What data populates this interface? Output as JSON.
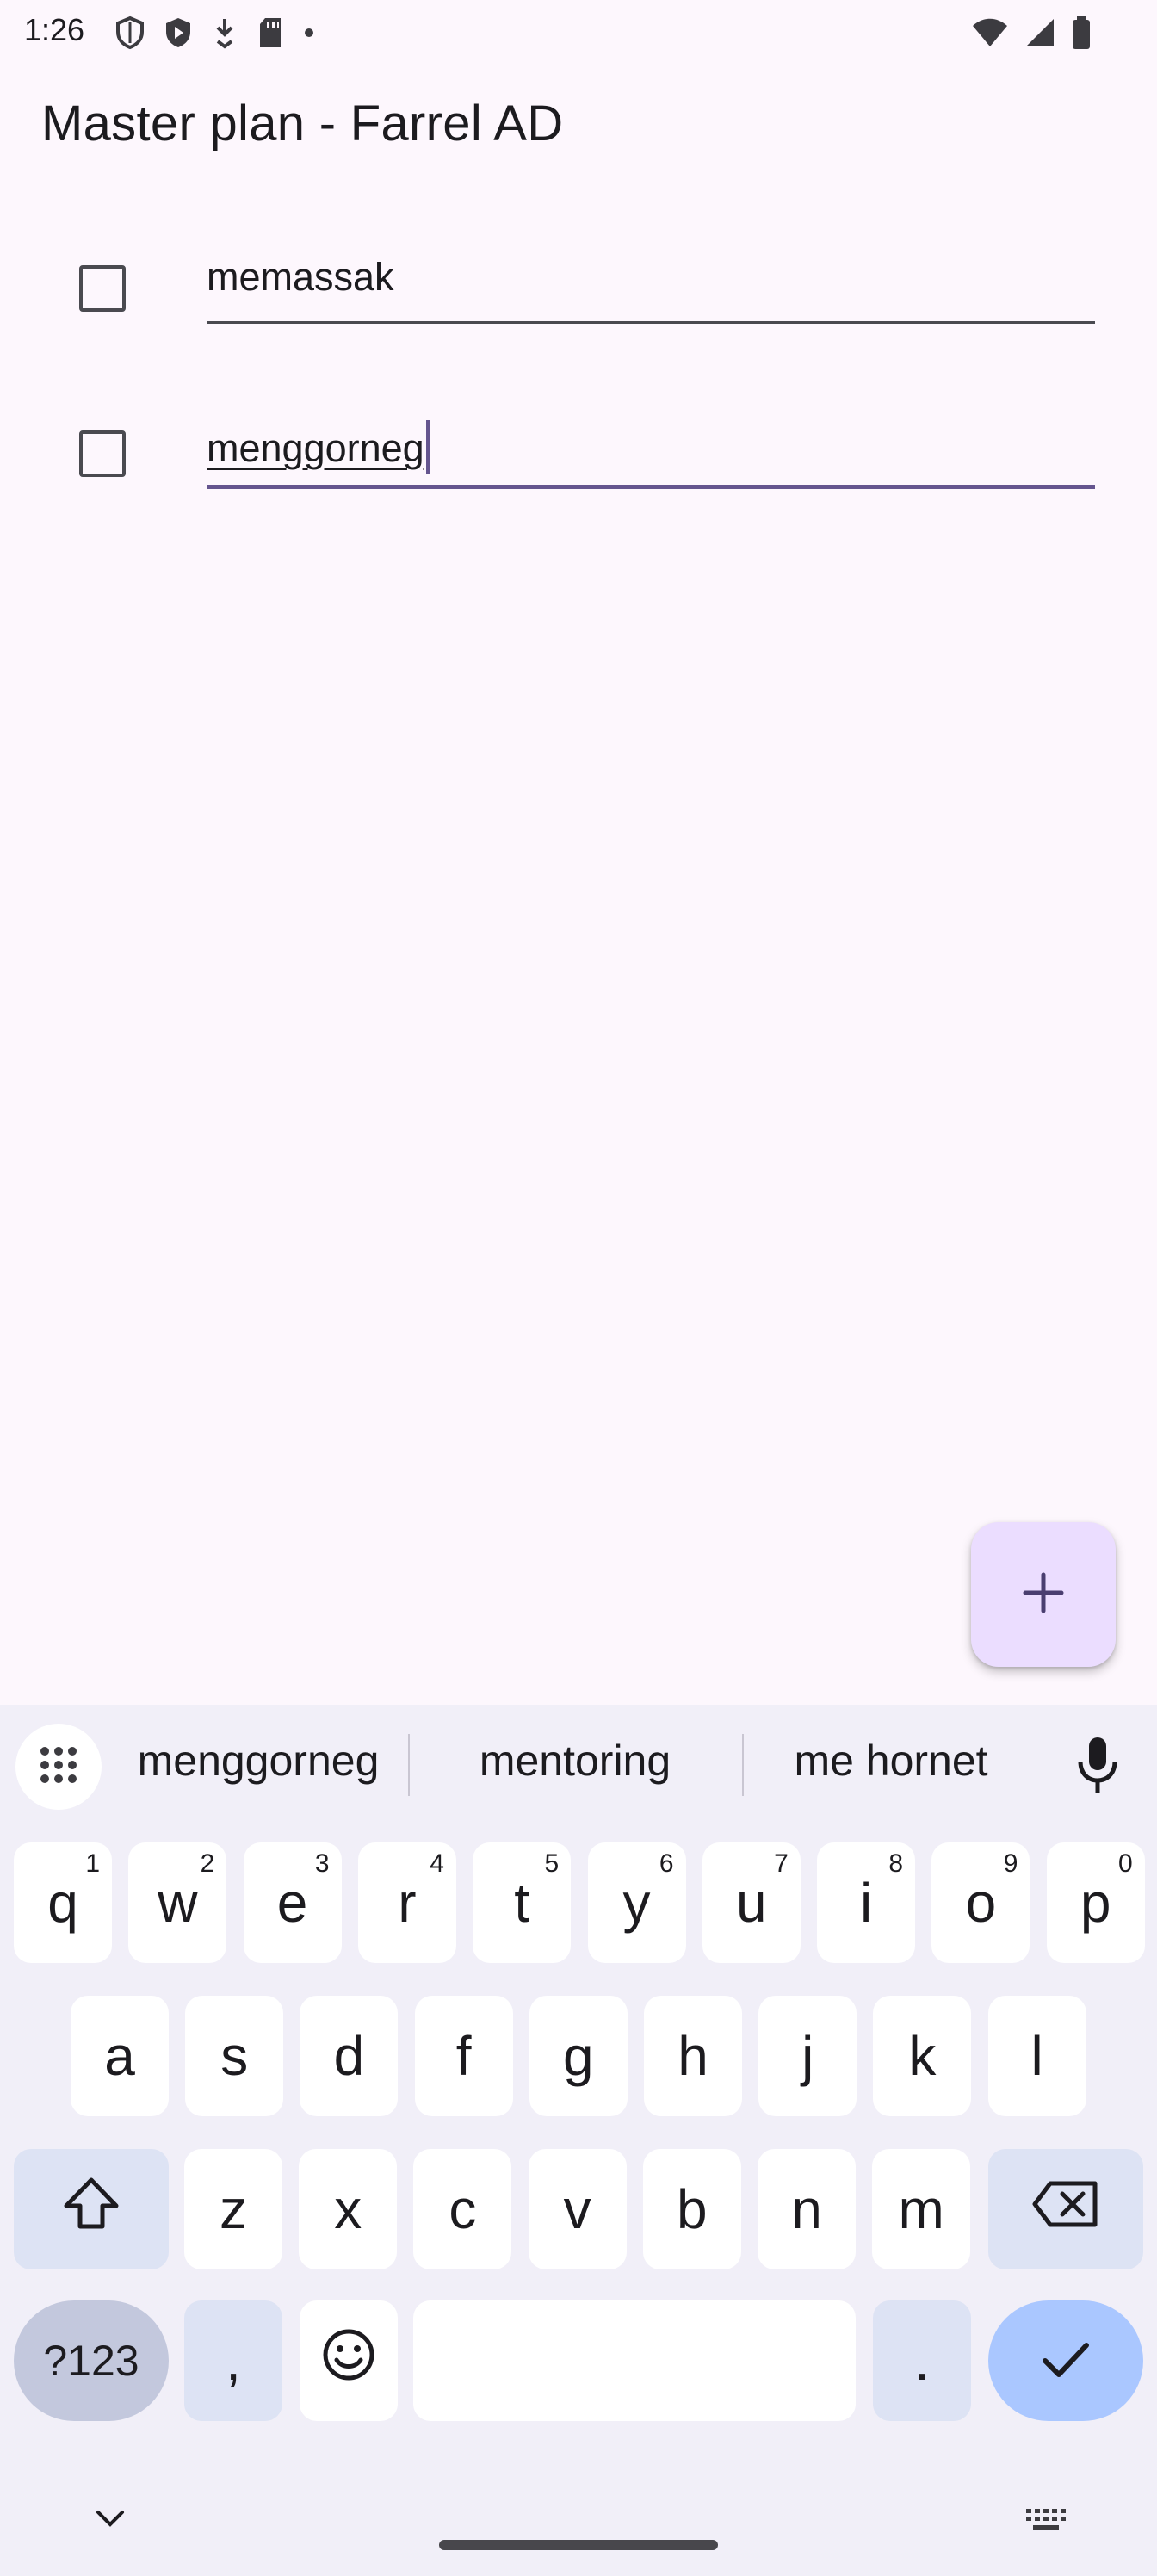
{
  "status_bar": {
    "time": "1:26",
    "left_icons": [
      "shield-outline-icon",
      "shield-play-icon",
      "download-icon",
      "sd-card-icon",
      "dot-icon"
    ],
    "right_icons": [
      "wifi-icon",
      "signal-icon",
      "battery-icon"
    ]
  },
  "app_bar": {
    "title": "Master plan - Farrel AD"
  },
  "todos": [
    {
      "text": "memassak",
      "checked": false,
      "focused": false
    },
    {
      "text": "menggorneg",
      "checked": false,
      "focused": true
    }
  ],
  "fab": {
    "icon": "plus-icon"
  },
  "keyboard": {
    "suggestions": [
      "menggorneg",
      "mentoring",
      "me hornet"
    ],
    "row1": [
      {
        "k": "q",
        "h": "1"
      },
      {
        "k": "w",
        "h": "2"
      },
      {
        "k": "e",
        "h": "3"
      },
      {
        "k": "r",
        "h": "4"
      },
      {
        "k": "t",
        "h": "5"
      },
      {
        "k": "y",
        "h": "6"
      },
      {
        "k": "u",
        "h": "7"
      },
      {
        "k": "i",
        "h": "8"
      },
      {
        "k": "o",
        "h": "9"
      },
      {
        "k": "p",
        "h": "0"
      }
    ],
    "row2": [
      "a",
      "s",
      "d",
      "f",
      "g",
      "h",
      "j",
      "k",
      "l"
    ],
    "row3": [
      "z",
      "x",
      "c",
      "v",
      "b",
      "n",
      "m"
    ],
    "symbols_label": "?123",
    "comma_label": ",",
    "period_label": "."
  },
  "colors": {
    "background": "#fdf7fd",
    "accent": "#65558f",
    "fab": "#ebddff",
    "keyboard": "#f1eff8",
    "enter_key": "#aac7ff"
  }
}
